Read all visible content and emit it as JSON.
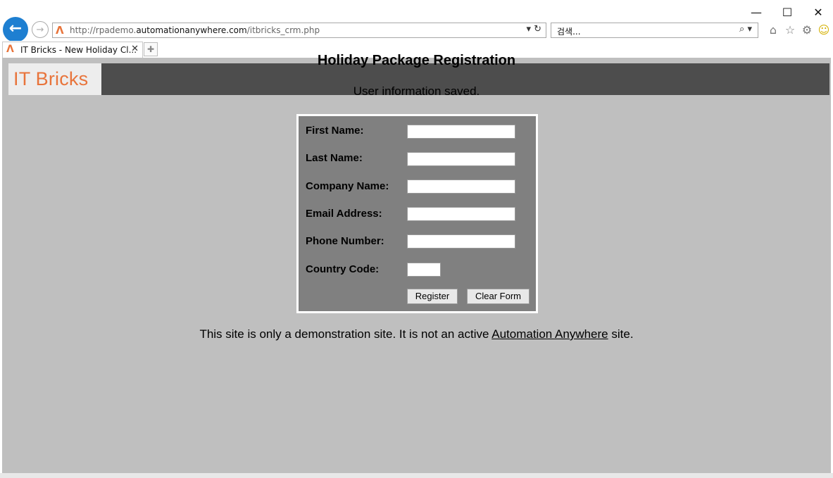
{
  "browser": {
    "window_controls": {
      "minimize": "—",
      "maximize": "☐",
      "close": "✕"
    },
    "address": {
      "prefix": "http://rpademo.",
      "domain": "automationanywhere.com",
      "path": "/itbricks_crm.php"
    },
    "search_placeholder": "검색...",
    "tab_title": "IT Bricks - New Holiday Cl...",
    "icons": [
      "back-icon",
      "forward-icon",
      "home-icon",
      "favorites-star-icon",
      "settings-gear-icon",
      "smiley-feedback-icon"
    ]
  },
  "site": {
    "brand": "IT Bricks",
    "brand_color": "#e8743b",
    "header_color": "#4d4d4d"
  },
  "main": {
    "title": "Holiday Package Registration",
    "status_message": "User information saved.",
    "annotation_color": "#e00000"
  },
  "form": {
    "fields": [
      {
        "label": "First Name:",
        "value": ""
      },
      {
        "label": "Last Name:",
        "value": ""
      },
      {
        "label": "Company Name:",
        "value": ""
      },
      {
        "label": "Email Address:",
        "value": ""
      },
      {
        "label": "Phone Number:",
        "value": ""
      },
      {
        "label": "Country Code:",
        "value": ""
      }
    ],
    "register_label": "Register",
    "clear_label": "Clear Form"
  },
  "footer": {
    "text_before": "This site is only a demonstration site. It is not an active ",
    "link_text": "Automation Anywhere",
    "text_after": " site."
  }
}
